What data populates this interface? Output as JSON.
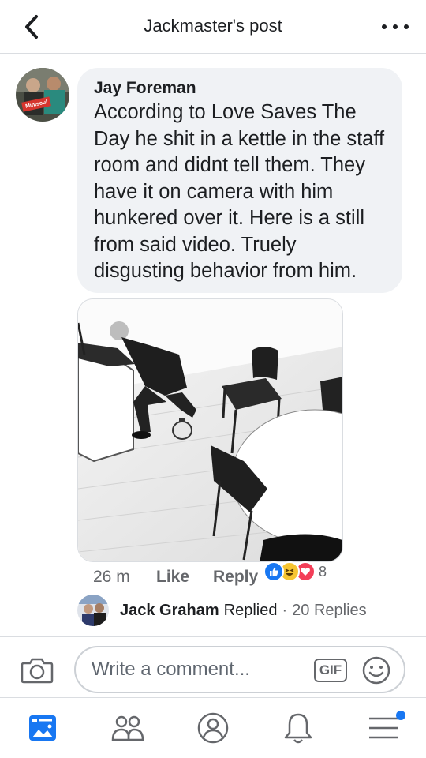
{
  "header": {
    "title": "Jackmaster's post"
  },
  "comment": {
    "author": "Jay Foreman",
    "text": "According to Love Saves The Day he shit in a kettle in the staff room and didnt tell them. They have it on camera with him hunkered over it. Here is a still from said video. Truely disgusting behavior from him.",
    "avatar_badge": "Minisoul",
    "time": "26 m",
    "like_label": "Like",
    "reply_label": "Reply",
    "reaction_count": "8"
  },
  "reply_preview": {
    "name": "Jack Graham",
    "verb": "Replied",
    "separator": "·",
    "count": "20 Replies"
  },
  "composer": {
    "placeholder": "Write a comment...",
    "gif_label": "GIF"
  },
  "icons": [
    "back-icon",
    "more-icon",
    "camera-icon",
    "gif-icon",
    "emoji-icon",
    "news-feed-icon",
    "friends-icon",
    "profile-icon",
    "notifications-icon",
    "menu-icon"
  ],
  "colors": {
    "accent": "#1877f2",
    "bubble": "#f0f2f5",
    "love": "#f33e58",
    "haha": "#f7c531"
  }
}
